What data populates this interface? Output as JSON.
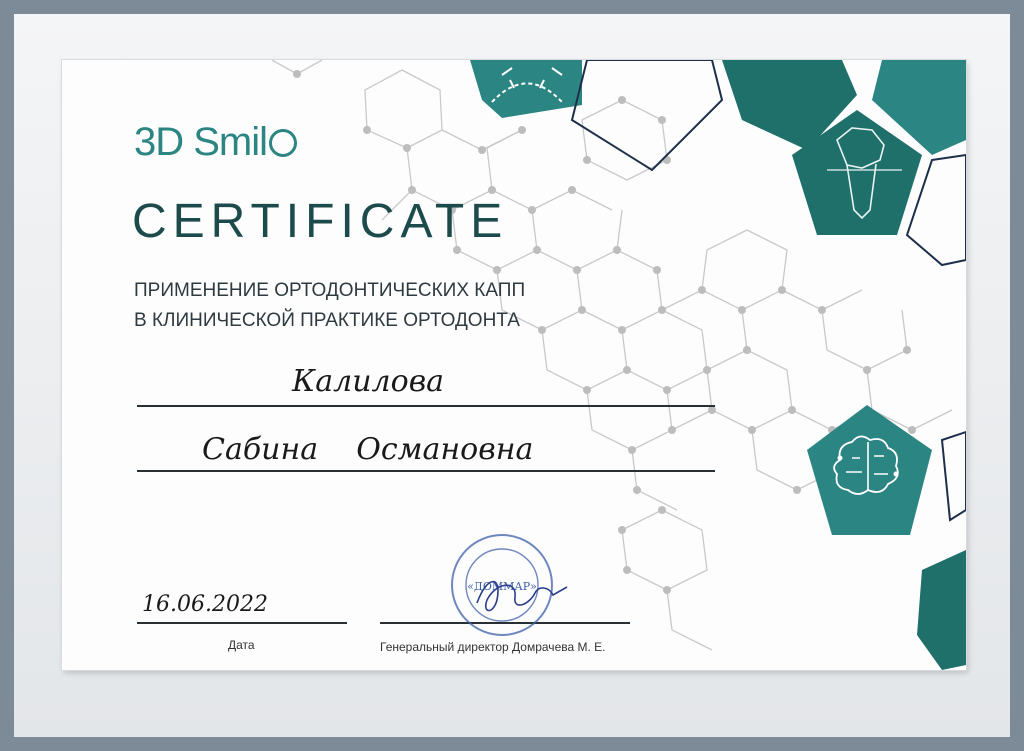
{
  "logo": {
    "text": "3D Smil"
  },
  "certificate_title": "CERTIFICATE",
  "course": {
    "line1": "ПРИМЕНЕНИЕ ОРТОДОНТИЧЕСКИХ КАПП",
    "line2": "В КЛИНИЧЕСКОЙ ПРАКТИКЕ ОРТОДОНТА"
  },
  "recipient": {
    "surname": "Калилова",
    "first_and_patronymic": "Сабина    Османовна"
  },
  "date": {
    "value": "16.06.2022",
    "label": "Дата"
  },
  "signatory": {
    "label": "Генеральный директор Домрачева М. Е."
  },
  "stamp": {
    "center_text": "«ДОММАР»"
  },
  "colors": {
    "teal": "#2b8582",
    "dark_teal": "#1f6f6a",
    "navy": "#1d2f4a",
    "node_gray": "#bdbdbd"
  },
  "icons": [
    "aligner-arrows-icon",
    "tooth-icon",
    "brain-circuit-icon"
  ]
}
